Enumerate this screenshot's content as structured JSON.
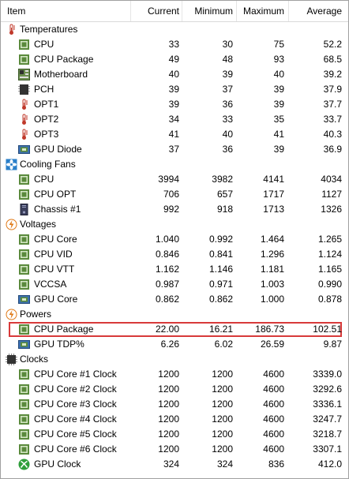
{
  "columns": {
    "item": "Item",
    "current": "Current",
    "minimum": "Minimum",
    "maximum": "Maximum",
    "average": "Average"
  },
  "groups": [
    {
      "label": "Temperatures",
      "icon": "thermometer-icon",
      "items": [
        {
          "label": "CPU",
          "icon": "chip-icon",
          "cur": "33",
          "min": "30",
          "max": "75",
          "avg": "52.2"
        },
        {
          "label": "CPU Package",
          "icon": "chip-icon",
          "cur": "49",
          "min": "48",
          "max": "93",
          "avg": "68.5"
        },
        {
          "label": "Motherboard",
          "icon": "motherboard-icon",
          "cur": "40",
          "min": "39",
          "max": "40",
          "avg": "39.2"
        },
        {
          "label": "PCH",
          "icon": "pch-chip-icon",
          "cur": "39",
          "min": "37",
          "max": "39",
          "avg": "37.9"
        },
        {
          "label": "OPT1",
          "icon": "thermometer-icon",
          "cur": "39",
          "min": "36",
          "max": "39",
          "avg": "37.7"
        },
        {
          "label": "OPT2",
          "icon": "thermometer-icon",
          "cur": "34",
          "min": "33",
          "max": "35",
          "avg": "33.7"
        },
        {
          "label": "OPT3",
          "icon": "thermometer-icon",
          "cur": "41",
          "min": "40",
          "max": "41",
          "avg": "40.3"
        },
        {
          "label": "GPU Diode",
          "icon": "gpu-icon",
          "cur": "37",
          "min": "36",
          "max": "39",
          "avg": "36.9"
        }
      ]
    },
    {
      "label": "Cooling Fans",
      "icon": "fan-icon",
      "items": [
        {
          "label": "CPU",
          "icon": "chip-icon",
          "cur": "3994",
          "min": "3982",
          "max": "4141",
          "avg": "4034"
        },
        {
          "label": "CPU OPT",
          "icon": "chip-icon",
          "cur": "706",
          "min": "657",
          "max": "1717",
          "avg": "1127"
        },
        {
          "label": "Chassis #1",
          "icon": "chassis-icon",
          "cur": "992",
          "min": "918",
          "max": "1713",
          "avg": "1326"
        }
      ]
    },
    {
      "label": "Voltages",
      "icon": "lightning-icon",
      "items": [
        {
          "label": "CPU Core",
          "icon": "chip-icon",
          "cur": "1.040",
          "min": "0.992",
          "max": "1.464",
          "avg": "1.265"
        },
        {
          "label": "CPU VID",
          "icon": "chip-icon",
          "cur": "0.846",
          "min": "0.841",
          "max": "1.296",
          "avg": "1.124"
        },
        {
          "label": "CPU VTT",
          "icon": "chip-icon",
          "cur": "1.162",
          "min": "1.146",
          "max": "1.181",
          "avg": "1.165"
        },
        {
          "label": "VCCSA",
          "icon": "chip-icon",
          "cur": "0.987",
          "min": "0.971",
          "max": "1.003",
          "avg": "0.990"
        },
        {
          "label": "GPU Core",
          "icon": "gpu-icon",
          "cur": "0.862",
          "min": "0.862",
          "max": "1.000",
          "avg": "0.878"
        }
      ]
    },
    {
      "label": "Powers",
      "icon": "lightning-icon",
      "items": [
        {
          "label": "CPU Package",
          "icon": "chip-icon",
          "cur": "22.00",
          "min": "16.21",
          "max": "186.73",
          "avg": "102.51",
          "highlight": true
        },
        {
          "label": "GPU TDP%",
          "icon": "gpu-icon",
          "cur": "6.26",
          "min": "6.02",
          "max": "26.59",
          "avg": "9.87"
        }
      ]
    },
    {
      "label": "Clocks",
      "icon": "clock-chip-icon",
      "items": [
        {
          "label": "CPU Core #1 Clock",
          "icon": "chip-icon",
          "cur": "1200",
          "min": "1200",
          "max": "4600",
          "avg": "3339.0"
        },
        {
          "label": "CPU Core #2 Clock",
          "icon": "chip-icon",
          "cur": "1200",
          "min": "1200",
          "max": "4600",
          "avg": "3292.6"
        },
        {
          "label": "CPU Core #3 Clock",
          "icon": "chip-icon",
          "cur": "1200",
          "min": "1200",
          "max": "4600",
          "avg": "3336.1"
        },
        {
          "label": "CPU Core #4 Clock",
          "icon": "chip-icon",
          "cur": "1200",
          "min": "1200",
          "max": "4600",
          "avg": "3247.7"
        },
        {
          "label": "CPU Core #5 Clock",
          "icon": "chip-icon",
          "cur": "1200",
          "min": "1200",
          "max": "4600",
          "avg": "3218.7"
        },
        {
          "label": "CPU Core #6 Clock",
          "icon": "chip-icon",
          "cur": "1200",
          "min": "1200",
          "max": "4600",
          "avg": "3307.1"
        },
        {
          "label": "GPU Clock",
          "icon": "xbox-icon",
          "cur": "324",
          "min": "324",
          "max": "836",
          "avg": "412.0"
        }
      ]
    }
  ],
  "colors": {
    "highlight_border": "#d83a3a",
    "chip_green": "#5a8a3c",
    "fan_blue": "#2a7fc9",
    "thermo_red": "#c0392b",
    "lightning_orange": "#e07b1a",
    "xbox_green": "#2e9e3a"
  }
}
